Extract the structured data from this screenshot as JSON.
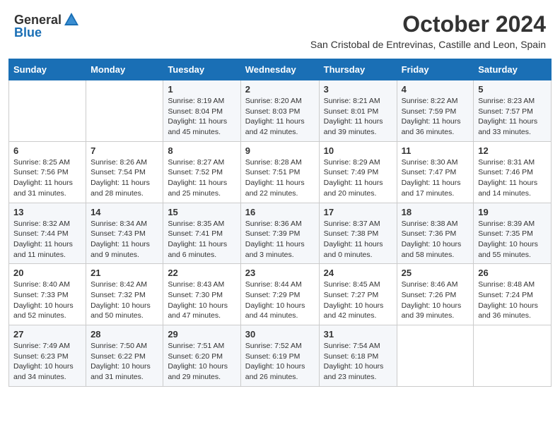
{
  "header": {
    "logo_general": "General",
    "logo_blue": "Blue",
    "month_title": "October 2024",
    "subtitle": "San Cristobal de Entrevinas, Castille and Leon, Spain"
  },
  "weekdays": [
    "Sunday",
    "Monday",
    "Tuesday",
    "Wednesday",
    "Thursday",
    "Friday",
    "Saturday"
  ],
  "weeks": [
    [
      {
        "day": "",
        "info": ""
      },
      {
        "day": "",
        "info": ""
      },
      {
        "day": "1",
        "info": "Sunrise: 8:19 AM\nSunset: 8:04 PM\nDaylight: 11 hours and 45 minutes."
      },
      {
        "day": "2",
        "info": "Sunrise: 8:20 AM\nSunset: 8:03 PM\nDaylight: 11 hours and 42 minutes."
      },
      {
        "day": "3",
        "info": "Sunrise: 8:21 AM\nSunset: 8:01 PM\nDaylight: 11 hours and 39 minutes."
      },
      {
        "day": "4",
        "info": "Sunrise: 8:22 AM\nSunset: 7:59 PM\nDaylight: 11 hours and 36 minutes."
      },
      {
        "day": "5",
        "info": "Sunrise: 8:23 AM\nSunset: 7:57 PM\nDaylight: 11 hours and 33 minutes."
      }
    ],
    [
      {
        "day": "6",
        "info": "Sunrise: 8:25 AM\nSunset: 7:56 PM\nDaylight: 11 hours and 31 minutes."
      },
      {
        "day": "7",
        "info": "Sunrise: 8:26 AM\nSunset: 7:54 PM\nDaylight: 11 hours and 28 minutes."
      },
      {
        "day": "8",
        "info": "Sunrise: 8:27 AM\nSunset: 7:52 PM\nDaylight: 11 hours and 25 minutes."
      },
      {
        "day": "9",
        "info": "Sunrise: 8:28 AM\nSunset: 7:51 PM\nDaylight: 11 hours and 22 minutes."
      },
      {
        "day": "10",
        "info": "Sunrise: 8:29 AM\nSunset: 7:49 PM\nDaylight: 11 hours and 20 minutes."
      },
      {
        "day": "11",
        "info": "Sunrise: 8:30 AM\nSunset: 7:47 PM\nDaylight: 11 hours and 17 minutes."
      },
      {
        "day": "12",
        "info": "Sunrise: 8:31 AM\nSunset: 7:46 PM\nDaylight: 11 hours and 14 minutes."
      }
    ],
    [
      {
        "day": "13",
        "info": "Sunrise: 8:32 AM\nSunset: 7:44 PM\nDaylight: 11 hours and 11 minutes."
      },
      {
        "day": "14",
        "info": "Sunrise: 8:34 AM\nSunset: 7:43 PM\nDaylight: 11 hours and 9 minutes."
      },
      {
        "day": "15",
        "info": "Sunrise: 8:35 AM\nSunset: 7:41 PM\nDaylight: 11 hours and 6 minutes."
      },
      {
        "day": "16",
        "info": "Sunrise: 8:36 AM\nSunset: 7:39 PM\nDaylight: 11 hours and 3 minutes."
      },
      {
        "day": "17",
        "info": "Sunrise: 8:37 AM\nSunset: 7:38 PM\nDaylight: 11 hours and 0 minutes."
      },
      {
        "day": "18",
        "info": "Sunrise: 8:38 AM\nSunset: 7:36 PM\nDaylight: 10 hours and 58 minutes."
      },
      {
        "day": "19",
        "info": "Sunrise: 8:39 AM\nSunset: 7:35 PM\nDaylight: 10 hours and 55 minutes."
      }
    ],
    [
      {
        "day": "20",
        "info": "Sunrise: 8:40 AM\nSunset: 7:33 PM\nDaylight: 10 hours and 52 minutes."
      },
      {
        "day": "21",
        "info": "Sunrise: 8:42 AM\nSunset: 7:32 PM\nDaylight: 10 hours and 50 minutes."
      },
      {
        "day": "22",
        "info": "Sunrise: 8:43 AM\nSunset: 7:30 PM\nDaylight: 10 hours and 47 minutes."
      },
      {
        "day": "23",
        "info": "Sunrise: 8:44 AM\nSunset: 7:29 PM\nDaylight: 10 hours and 44 minutes."
      },
      {
        "day": "24",
        "info": "Sunrise: 8:45 AM\nSunset: 7:27 PM\nDaylight: 10 hours and 42 minutes."
      },
      {
        "day": "25",
        "info": "Sunrise: 8:46 AM\nSunset: 7:26 PM\nDaylight: 10 hours and 39 minutes."
      },
      {
        "day": "26",
        "info": "Sunrise: 8:48 AM\nSunset: 7:24 PM\nDaylight: 10 hours and 36 minutes."
      }
    ],
    [
      {
        "day": "27",
        "info": "Sunrise: 7:49 AM\nSunset: 6:23 PM\nDaylight: 10 hours and 34 minutes."
      },
      {
        "day": "28",
        "info": "Sunrise: 7:50 AM\nSunset: 6:22 PM\nDaylight: 10 hours and 31 minutes."
      },
      {
        "day": "29",
        "info": "Sunrise: 7:51 AM\nSunset: 6:20 PM\nDaylight: 10 hours and 29 minutes."
      },
      {
        "day": "30",
        "info": "Sunrise: 7:52 AM\nSunset: 6:19 PM\nDaylight: 10 hours and 26 minutes."
      },
      {
        "day": "31",
        "info": "Sunrise: 7:54 AM\nSunset: 6:18 PM\nDaylight: 10 hours and 23 minutes."
      },
      {
        "day": "",
        "info": ""
      },
      {
        "day": "",
        "info": ""
      }
    ]
  ]
}
